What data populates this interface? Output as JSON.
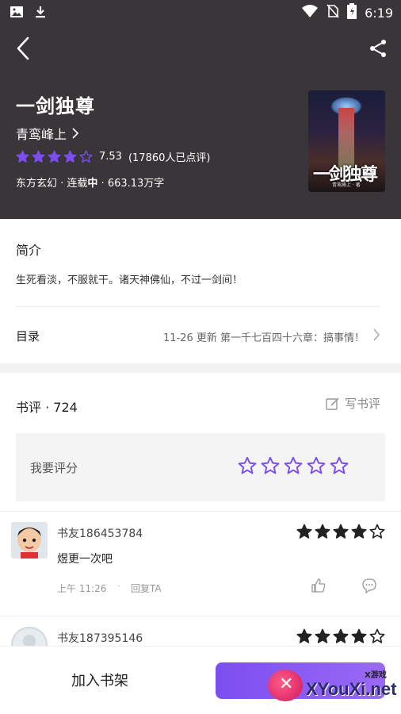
{
  "status_bar": {
    "time": "6:19",
    "icons": [
      "image-icon",
      "download-icon",
      "wifi-icon",
      "no-sim-icon",
      "battery-icon"
    ]
  },
  "book": {
    "title": "一剑独尊",
    "author": "青鸾峰上",
    "rating": "7.53",
    "rating_value": 4,
    "rating_max": 5,
    "rating_count": "(17860人已点评)",
    "meta_prefix": "东方玄幻 · 连载",
    "meta_status": "中",
    "meta_suffix": " · 663.13万字",
    "cover_title": "一剑独尊",
    "cover_author": "青鸾峰上 · 著"
  },
  "intro_section": {
    "title": "简介",
    "text": "生死看淡，不服就干。诸天神佛仙，不过一剑间！"
  },
  "toc": {
    "label": "目录",
    "update": "11-26 更新  第一千七百四十六章：搞事情！"
  },
  "reviews": {
    "title": "书评 · 724",
    "write_label": "写书评",
    "rate_prompt": "我要评分",
    "items": [
      {
        "user": "书友186453784",
        "text": "煜更一次吧",
        "time": "上午 11:26",
        "reply": "回复TA",
        "stars": 4
      },
      {
        "user": "书友187395146",
        "text": "",
        "time": "",
        "reply": "",
        "stars": 4
      }
    ]
  },
  "bottom": {
    "add_shelf": "加入书架"
  },
  "watermark": {
    "brand": "XYouXi.net",
    "small": "X游戏"
  },
  "colors": {
    "header_bg": "#3a3538",
    "accent": "#7b4ef0",
    "star_dark": "#222222"
  }
}
